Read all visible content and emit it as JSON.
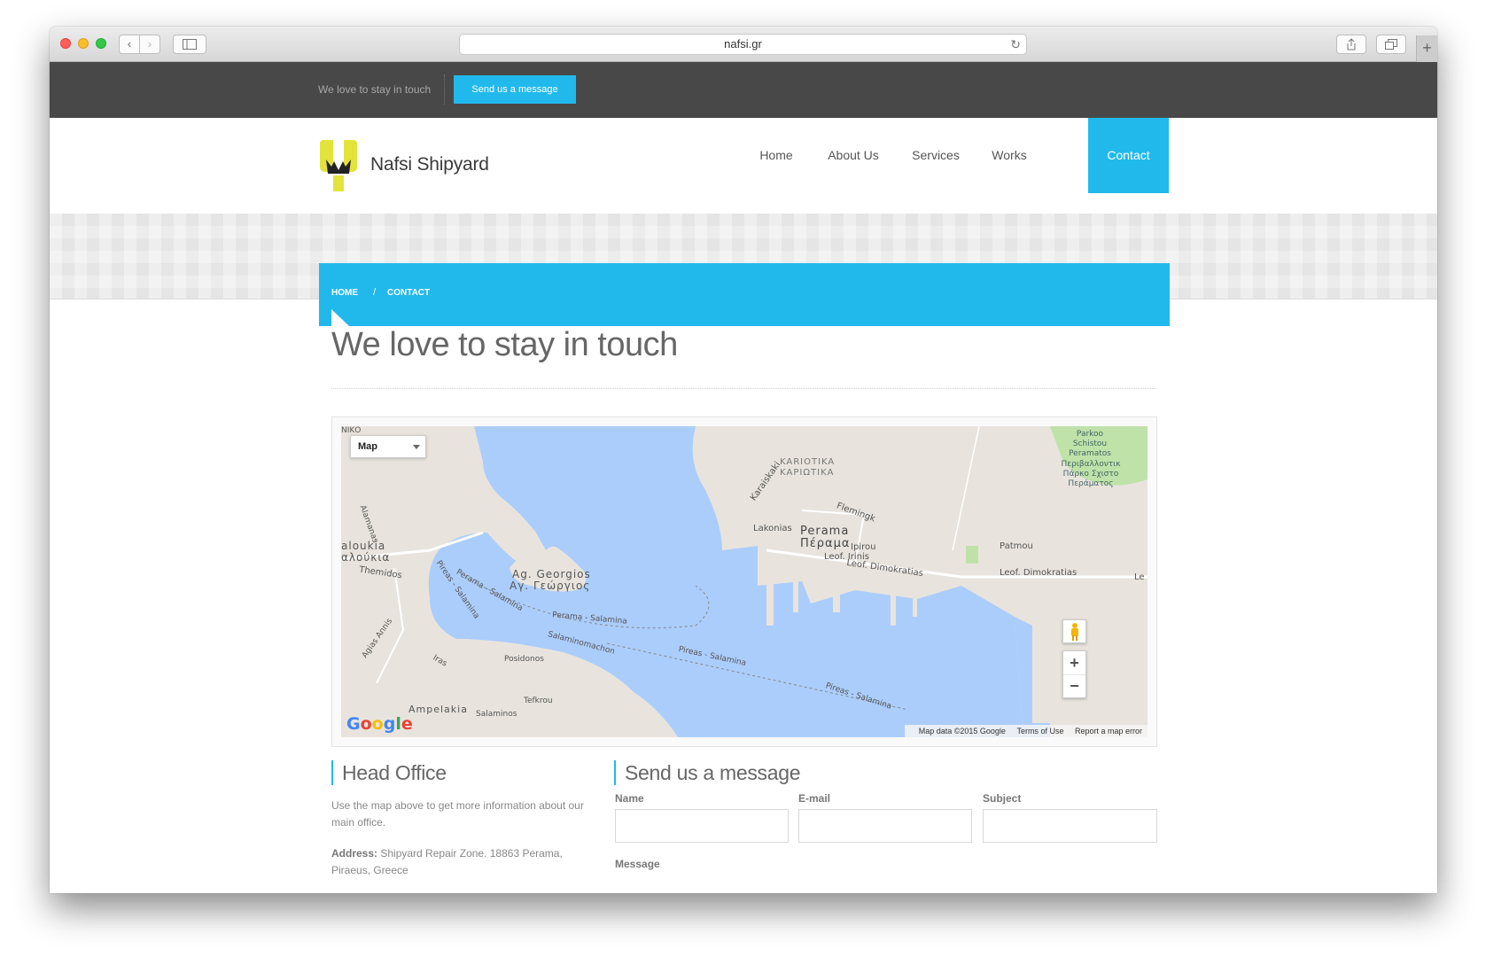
{
  "browser": {
    "url": "nafsi.gr",
    "traffic_lights": [
      "#fc5f57",
      "#fdbc2e",
      "#33c748"
    ]
  },
  "topbar": {
    "tagline": "We love to stay in touch",
    "cta_label": "Send us a message"
  },
  "header": {
    "logo_text": "Nafsi Shipyard",
    "nav": [
      "Home",
      "About Us",
      "Services",
      "Works",
      "Contact"
    ],
    "active_nav": "Contact",
    "accent_color": "#21b9ec",
    "logo_color": "#e2e43c"
  },
  "breadcrumb": {
    "home": "HOME",
    "separator": "/",
    "current": "CONTACT"
  },
  "page": {
    "title": "We love to stay in touch"
  },
  "map": {
    "type_label": "Map",
    "places": {
      "kariotika": "KARIOTIKA",
      "kariotika_gr": "ΚΑΡΙΩΤΙΚΑ",
      "park": "Parkoo Schistou Peramatos",
      "park_gr": "Περιβαλλοντικ Πάρκο Σχιστο Περάματος",
      "karaiskaki": "Karaiskaki",
      "flemingk": "Flemingk",
      "lakonias": "Lakonias",
      "perama": "Perama",
      "perama_gr": "Πέραμα",
      "ipirou": "Ipirou",
      "leof_irinis": "Leof. Irinis",
      "leof_dimokratias": "Leof. Dimokratias",
      "patmou": "Patmou",
      "leof_dimokratias_2": "Leof. Dimokratias",
      "le": "Le",
      "alamanas": "Alamanas",
      "aloukia": "aloukia",
      "aloukia_gr": "αλούκια",
      "themidos": "Themidos",
      "ag_georgios": "Ag. Georgios",
      "ag_georgios_gr": "Αγ. Γεώργιος",
      "pireas_salamina": "Pireas - Salamina",
      "perama_salamina": "Perama - Salamina",
      "perama_salamina_2": "Perama - Salamina",
      "salaminomachon": "Salaminomachon",
      "posidonos": "Posidonos",
      "pireas_salamina_2": "Pireas - Salamina",
      "pireas_salamina_3": "Pireas - Salamina",
      "agias_annis": "Agias Annis",
      "iras": "Iras",
      "ampelakia": "Ampelakia",
      "tefkrou": "Tefkrou",
      "salaminos": "Salaminos",
      "niko": "ΝΙΚΟ"
    },
    "zoom_in": "+",
    "zoom_out": "−",
    "attribution": [
      "Map data ©2015 Google",
      "Terms of Use",
      "Report a map error"
    ],
    "google_logo": "Google"
  },
  "office": {
    "heading": "Head Office",
    "description": "Use the map above to get more information about our main office.",
    "address_label": "Address:",
    "address": "Shipyard Repair Zone. 18863 Perama, Piraeus, Greece"
  },
  "form": {
    "heading": "Send us a message",
    "fields": {
      "name": "Name",
      "email": "E-mail",
      "subject": "Subject",
      "message": "Message"
    }
  }
}
